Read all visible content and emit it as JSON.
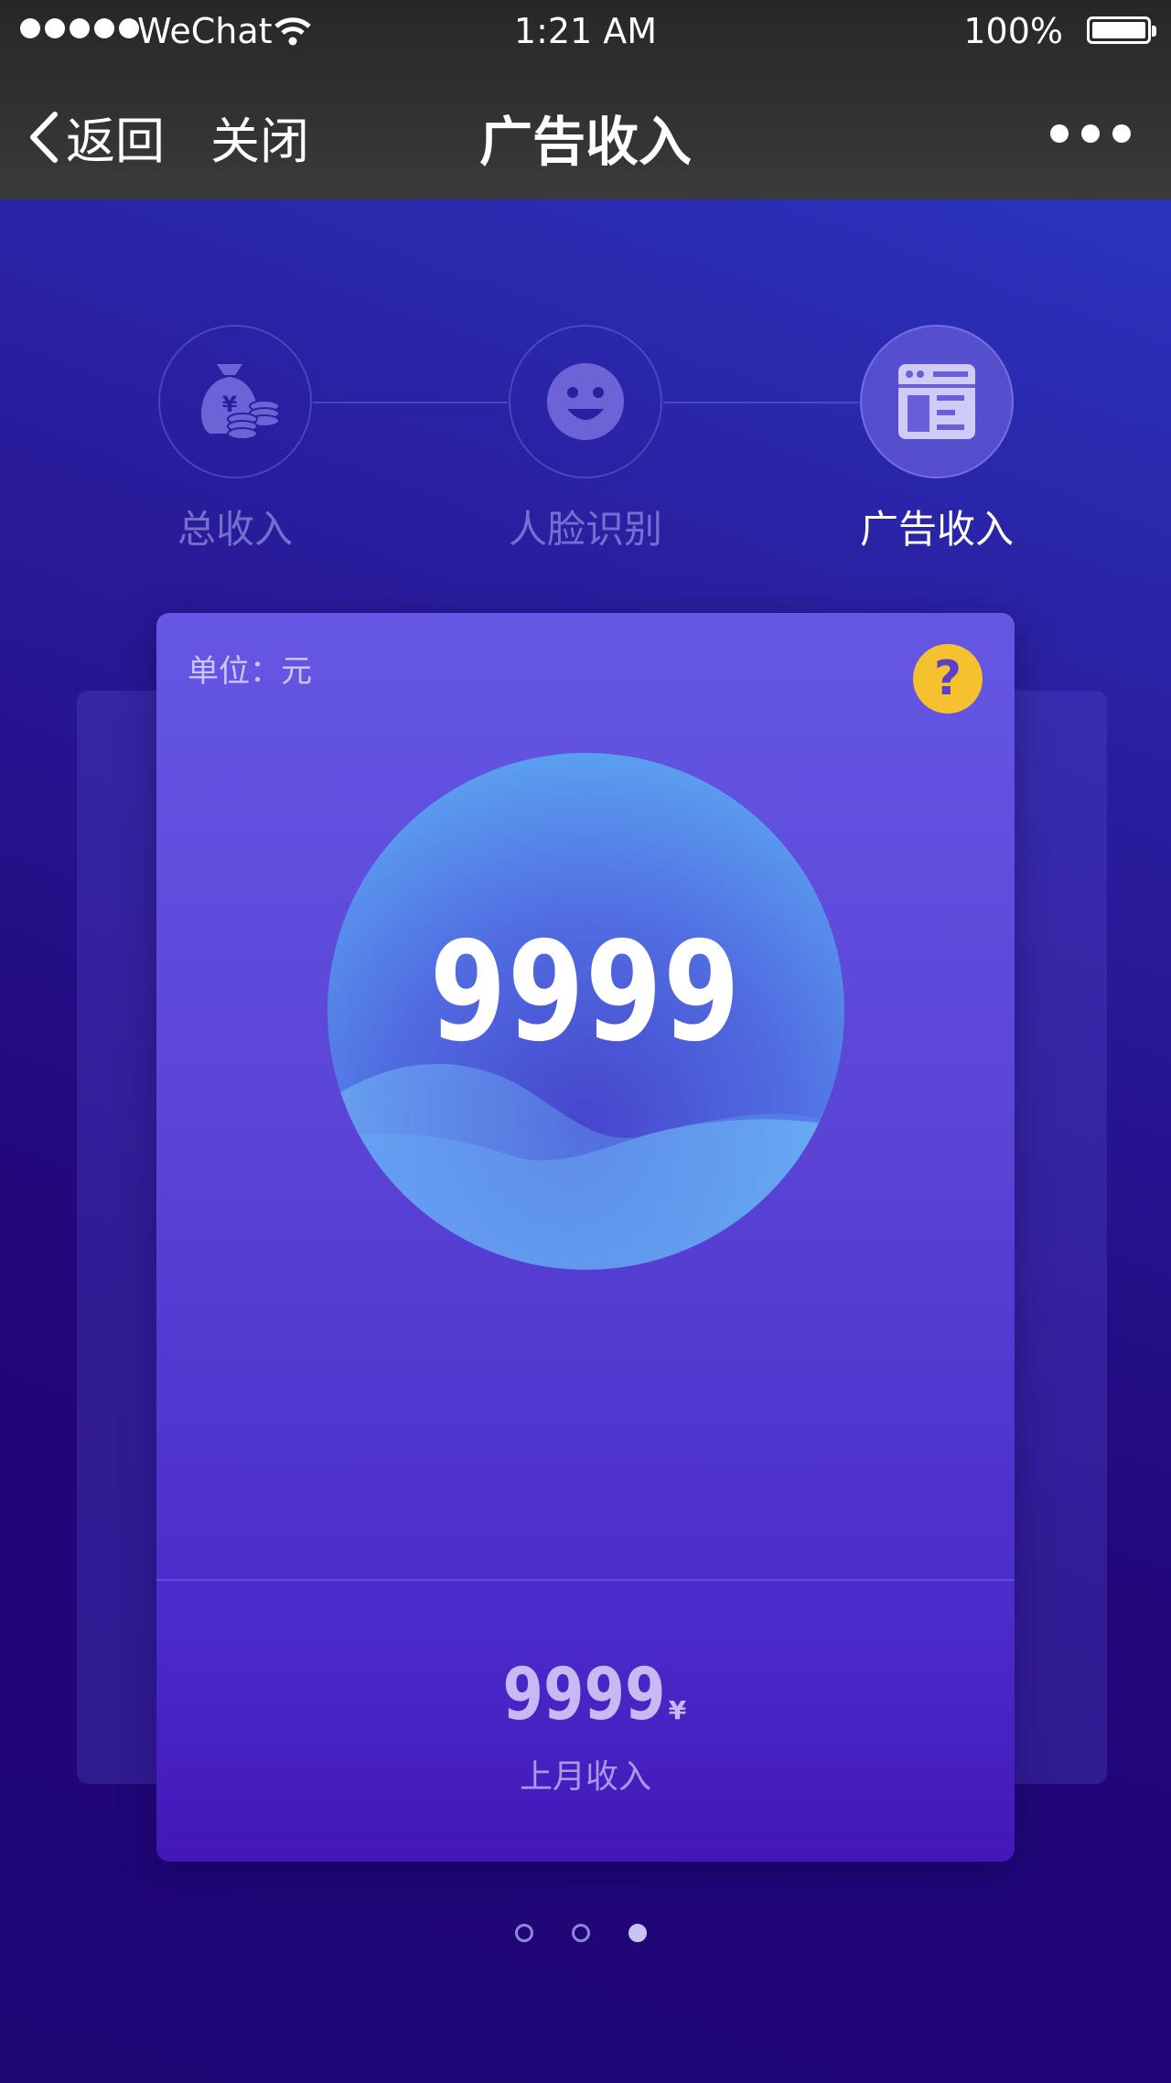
{
  "status_bar": {
    "carrier": "WeChat",
    "time": "1:21 AM",
    "battery": "100%",
    "icons": [
      "signal-dots-icon",
      "wifi-icon",
      "battery-icon"
    ]
  },
  "nav": {
    "back_label": "返回",
    "close_label": "关闭",
    "title": "广告收入",
    "icons": [
      "chevron-left-icon",
      "more-dots-icon"
    ]
  },
  "steps": [
    {
      "label": "总收入",
      "icon": "money-bag-coins-icon",
      "active": false
    },
    {
      "label": "人脸识别",
      "icon": "smiley-face-icon",
      "active": false
    },
    {
      "label": "广告收入",
      "icon": "ad-window-icon",
      "active": true
    }
  ],
  "card": {
    "unit_label": "单位：元",
    "help_symbol": "?",
    "main_value": "9999",
    "previous_value": "9999",
    "previous_currency": "¥",
    "previous_label": "上月收入"
  },
  "pagination": {
    "count": 3,
    "active_index": 2
  },
  "colors": {
    "accent_yellow": "#f5c12e",
    "card_top": "#6557e4",
    "card_bottom": "#4317b8",
    "orb_edge": "#5db8f8"
  }
}
